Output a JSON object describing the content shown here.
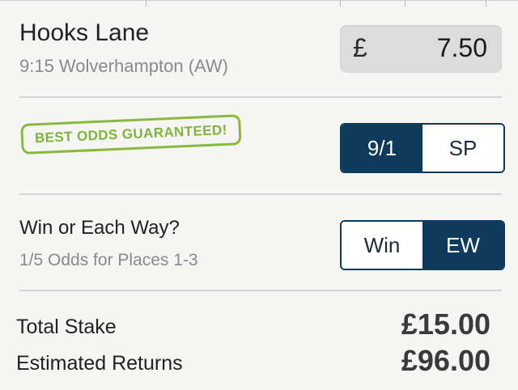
{
  "selection": {
    "horse": "Hooks Lane",
    "race": "9:15 Wolverhampton (AW)"
  },
  "stake": {
    "currency_symbol": "£",
    "value": "7.50"
  },
  "promo": {
    "badge_text": "BEST ODDS GUARANTEED!",
    "color": "#7fb53a"
  },
  "odds_toggle": {
    "options": [
      "9/1",
      "SP"
    ],
    "selected": "9/1"
  },
  "bet_type": {
    "question": "Win or Each Way?",
    "terms": "1/5 Odds for Places 1-3",
    "options": [
      "Win",
      "EW"
    ],
    "selected": "EW"
  },
  "summary": {
    "total_stake_label": "Total Stake",
    "total_stake_value": "£15.00",
    "returns_label": "Estimated Returns",
    "returns_value": "£96.00"
  },
  "colors": {
    "accent": "#0e3a5c",
    "background": "#f5f5f3"
  }
}
